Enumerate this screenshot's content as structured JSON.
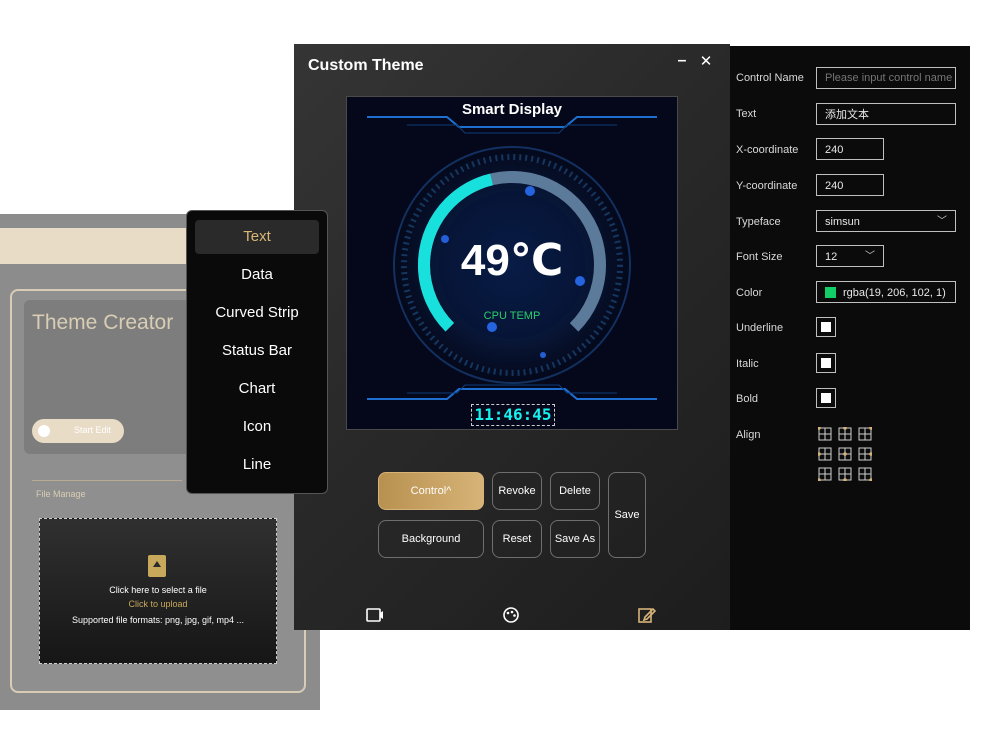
{
  "background_window": {
    "title": "Theme Creator",
    "start_edit_label": "Start Edit",
    "file_section_label": "File Manage",
    "dropzone": {
      "line1": "Click here to select a file",
      "line2": "Click to upload",
      "line3": "Supported file formats: png, jpg, gif, mp4 ..."
    }
  },
  "popup_menu": {
    "items": [
      "Text",
      "Data",
      "Curved Strip",
      "Status Bar",
      "Chart",
      "Icon",
      "Line"
    ],
    "active_index": 0
  },
  "main_window": {
    "title": "Custom Theme",
    "preview": {
      "display_title": "Smart Display",
      "temperature": "49℃",
      "gauge_label": "CPU TEMP",
      "clock": "11:46:45",
      "gauge_level": 0.45
    },
    "buttons": {
      "control": "Control",
      "revoke": "Revoke",
      "delete": "Delete",
      "save": "Save",
      "background": "Background",
      "reset": "Reset",
      "save_as": "Save As"
    },
    "bottom_icons": [
      "video-icon",
      "palette-icon",
      "edit-icon"
    ]
  },
  "properties": {
    "control_name": {
      "label": "Control Name",
      "placeholder": "Please input control name"
    },
    "text": {
      "label": "Text",
      "value": "添加文本"
    },
    "x_coordinate": {
      "label": "X-coordinate",
      "value": "240"
    },
    "y_coordinate": {
      "label": "Y-coordinate",
      "value": "240"
    },
    "typeface": {
      "label": "Typeface",
      "value": "simsun"
    },
    "font_size": {
      "label": "Font Size",
      "value": "12"
    },
    "color": {
      "label": "Color",
      "value": "rgba(19, 206, 102, 1)",
      "swatch": "#13ce66"
    },
    "underline": {
      "label": "Underline"
    },
    "italic": {
      "label": "Italic"
    },
    "bold": {
      "label": "Bold"
    },
    "align": {
      "label": "Align",
      "selected_index": 4
    }
  },
  "colors": {
    "accent_gold": "#d7b378",
    "gauge_cyan": "#18e0dc",
    "gauge_track": "#5c7a9a"
  }
}
